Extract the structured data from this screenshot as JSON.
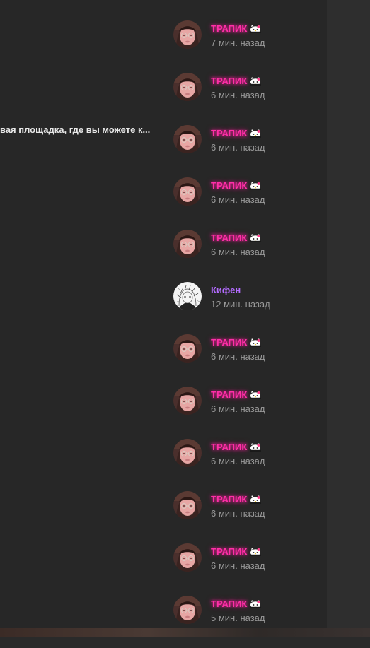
{
  "snippet": {
    "text": "вая площадка, где вы можете к..."
  },
  "colors": {
    "pink_name": "#ff2fa8",
    "purple_name": "#b36cff",
    "time": "#9a9a9a",
    "background": "#272727"
  },
  "feed": [
    {
      "name": "ТРАПИК",
      "time": "7 мин. назад",
      "avatar": "girl-avatar",
      "name_style": "pink",
      "badge": "hello-kitty-icon"
    },
    {
      "name": "ТРАПИК",
      "time": "6 мин. назад",
      "avatar": "girl-avatar",
      "name_style": "pink",
      "badge": "hello-kitty-icon"
    },
    {
      "name": "ТРАПИК",
      "time": "6 мин. назад",
      "avatar": "girl-avatar",
      "name_style": "pink",
      "badge": "hello-kitty-icon"
    },
    {
      "name": "ТРАПИК",
      "time": "6 мин. назад",
      "avatar": "girl-avatar",
      "name_style": "pink",
      "badge": "hello-kitty-icon"
    },
    {
      "name": "ТРАПИК",
      "time": "6 мин. назад",
      "avatar": "girl-avatar",
      "name_style": "pink",
      "badge": "hello-kitty-icon"
    },
    {
      "name": "Кифен",
      "time": "12 мин. назад",
      "avatar": "sketch-avatar",
      "name_style": "purple",
      "badge": ""
    },
    {
      "name": "ТРАПИК",
      "time": "6 мин. назад",
      "avatar": "girl-avatar",
      "name_style": "pink",
      "badge": "hello-kitty-icon"
    },
    {
      "name": "ТРАПИК",
      "time": "6 мин. назад",
      "avatar": "girl-avatar",
      "name_style": "pink",
      "badge": "hello-kitty-icon"
    },
    {
      "name": "ТРАПИК",
      "time": "6 мин. назад",
      "avatar": "girl-avatar",
      "name_style": "pink",
      "badge": "hello-kitty-icon"
    },
    {
      "name": "ТРАПИК",
      "time": "6 мин. назад",
      "avatar": "girl-avatar",
      "name_style": "pink",
      "badge": "hello-kitty-icon"
    },
    {
      "name": "ТРАПИК",
      "time": "6 мин. назад",
      "avatar": "girl-avatar",
      "name_style": "pink",
      "badge": "hello-kitty-icon"
    },
    {
      "name": "ТРАПИК",
      "time": "5 мин. назад",
      "avatar": "girl-avatar",
      "name_style": "pink",
      "badge": "hello-kitty-icon"
    }
  ]
}
